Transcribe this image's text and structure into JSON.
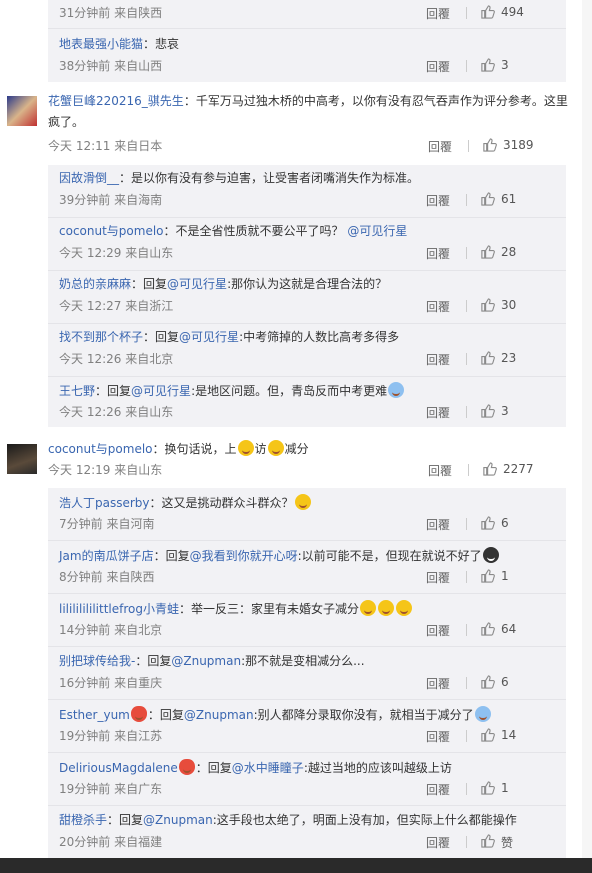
{
  "ui": {
    "reply_label": "回覆"
  },
  "top_group": [
    {
      "meta": "31分钟前 来自陕西",
      "likes": "494",
      "partial": true
    },
    {
      "user": "地表最强小能猫",
      "text": "悲哀",
      "meta": "38分钟前 来自山西",
      "likes": "3"
    }
  ],
  "comments": [
    {
      "user": "花蟹巨峰220216_骐先生",
      "text_line1": "千军万马过独木桥的中高考，以你有没有忍气吞声作为评分参考。这里",
      "text_line2": "疯了。",
      "meta": "今天 12:11 来自日本",
      "likes": "3189",
      "replies": [
        {
          "user": "因故滑倒__",
          "text": "是以你有没有参与迫害，让受害者闭嘴消失作为标准。",
          "meta": "39分钟前 来自海南",
          "likes": "61"
        },
        {
          "user": "coconut与pomelo",
          "text": "不是全省性质就不要公平了吗？",
          "mention": "@可见行星",
          "meta": "今天 12:29 来自山东",
          "likes": "28"
        },
        {
          "user": "奶总的亲麻麻",
          "prefix": "回复",
          "mention": "@可见行星",
          "text": ":那你认为这就是合理合法的？",
          "meta": "今天 12:27 来自浙江",
          "likes": "30"
        },
        {
          "user": "找不到那个杯子",
          "prefix": "回复",
          "mention": "@可见行星",
          "text": ":中考筛掉的人数比高考多得多",
          "meta": "今天 12:26 来自北京",
          "likes": "23"
        },
        {
          "user": "王七野",
          "prefix": "回复",
          "mention": "@可见行星",
          "text": ":是地区问题。但，青岛反而中考更难",
          "emoji": "hug",
          "meta": "今天 12:26 来自山东",
          "likes": "3"
        }
      ]
    },
    {
      "user": "coconut与pomelo",
      "text_a": "换句话说，上",
      "text_b": "访",
      "text_c": "减分",
      "meta": "今天 12:19 来自山东",
      "likes": "2277",
      "replies": [
        {
          "user": "浩人丁passerby",
          "text": "这又是挑动群众斗群众？",
          "emoji": "think",
          "meta": "7分钟前 来自河南",
          "likes": "6"
        },
        {
          "user": "Jam的南瓜饼子店",
          "prefix": "回复",
          "mention": "@我看到你就开心呀",
          "text": ":以前可能不是，但现在就说不好了",
          "emoji": "shock",
          "meta": "8分钟前 来自陕西",
          "likes": "1"
        },
        {
          "user": "lilililililittlefrog小青蛙",
          "text": "举一反三：家里有未婚女子减分",
          "emoji": "think3",
          "meta": "14分钟前 来自北京",
          "likes": "64"
        },
        {
          "user": "别把球传给我-",
          "prefix": "回复",
          "mention": "@Znupman",
          "text": ":那不就是变相减分么...",
          "meta": "16分钟前 来自重庆",
          "likes": "6"
        },
        {
          "user": "Esther_yum",
          "badge": true,
          "prefix": "回复",
          "mention": "@Znupman",
          "text": ":别人都降分录取你没有，就相当于减分了",
          "emoji": "hug",
          "meta": "19分钟前 来自江苏",
          "likes": "14"
        },
        {
          "user": "DeliriousMagdalene",
          "badge": true,
          "prefix": "回复",
          "mention": "@水中睡瞳子",
          "text": ":越过当地的应该叫越级上访",
          "meta": "19分钟前 来自广东",
          "likes": "1"
        },
        {
          "user": "甜橙杀手",
          "prefix": "回复",
          "mention": "@Znupman",
          "text": ":这手段也太绝了，明面上没有加，但实际上什么都能操作",
          "meta": "20分钟前 来自福建",
          "likes": "赞"
        }
      ]
    }
  ],
  "colors": {
    "link": "#3a66b0",
    "meta": "#808080",
    "reply_bg": "#f2f2f5"
  }
}
